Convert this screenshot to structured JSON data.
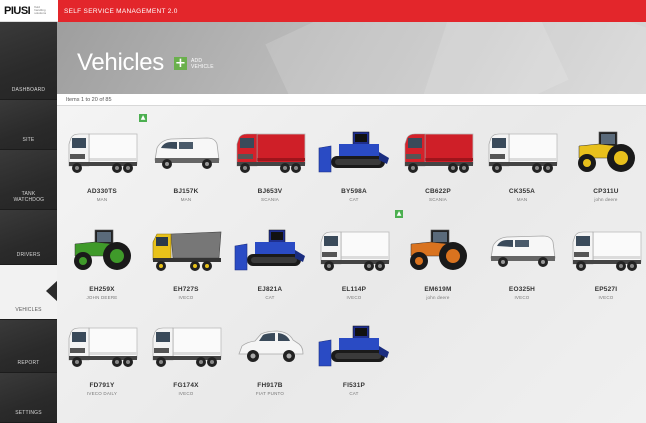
{
  "header": {
    "logo": "PIUSI",
    "logo_tagline": "fluid handling solutions",
    "app_title": "SELF SERVICE MANAGEMENT 2.0"
  },
  "sidebar": {
    "items": [
      {
        "label": "DASHBOARD"
      },
      {
        "label": "SITE"
      },
      {
        "label": "TANK WATCHDOG"
      },
      {
        "label": "DRIVERS"
      },
      {
        "label": "VEHICLES"
      },
      {
        "label": "REPORT"
      },
      {
        "label": "SETTINGS"
      }
    ]
  },
  "page": {
    "title": "Vehicles",
    "add_button": "ADD VEHICLE",
    "add_icon": "+",
    "pager_text": "Items 1 to 20 of 85"
  },
  "vehicles": [
    {
      "plate": "AD330TS",
      "brand": "MAN",
      "icon": "truck-white"
    },
    {
      "plate": "BJ157K",
      "brand": "MAN",
      "icon": "van-white"
    },
    {
      "plate": "BJ653V",
      "brand": "SCANIA",
      "icon": "truck-red"
    },
    {
      "plate": "BY598A",
      "brand": "CAT",
      "icon": "bulldozer-blue"
    },
    {
      "plate": "CB622P",
      "brand": "SCANIA",
      "icon": "truck-red"
    },
    {
      "plate": "CK355A",
      "brand": "MAN",
      "icon": "truck-white"
    },
    {
      "plate": "CP311U",
      "brand": "john deere",
      "icon": "tractor-yellow"
    },
    {
      "plate": "EH259X",
      "brand": "JOHN DEERE",
      "icon": "tractor-green"
    },
    {
      "plate": "EH727S",
      "brand": "IVECO",
      "icon": "dumptruck-yellow"
    },
    {
      "plate": "EJ821A",
      "brand": "CAT",
      "icon": "bulldozer-blue"
    },
    {
      "plate": "EL114P",
      "brand": "IVECO",
      "icon": "truck-white"
    },
    {
      "plate": "EM619M",
      "brand": "john deere",
      "icon": "tractor-orange"
    },
    {
      "plate": "EO325H",
      "brand": "IVECO",
      "icon": "van-white"
    },
    {
      "plate": "EP527I",
      "brand": "IVECO",
      "icon": "truck-white"
    },
    {
      "plate": "FD791Y",
      "brand": "IVECO DAILY",
      "icon": "truck-white"
    },
    {
      "plate": "FG174X",
      "brand": "IVECO",
      "icon": "truck-white"
    },
    {
      "plate": "FH917B",
      "brand": "FIAT PUNTO",
      "icon": "car-white"
    },
    {
      "plate": "FI531P",
      "brand": "CAT",
      "icon": "bulldozer-blue"
    }
  ],
  "markers": [
    {
      "icon": "alert-badge-icon",
      "glyph": "▲"
    },
    {
      "icon": "alert-badge-icon",
      "glyph": "▲"
    }
  ],
  "colors": {
    "brand_red": "#e3262b",
    "sidebar_dark": "#2b2b2b",
    "accent_green": "#6ab04c"
  }
}
